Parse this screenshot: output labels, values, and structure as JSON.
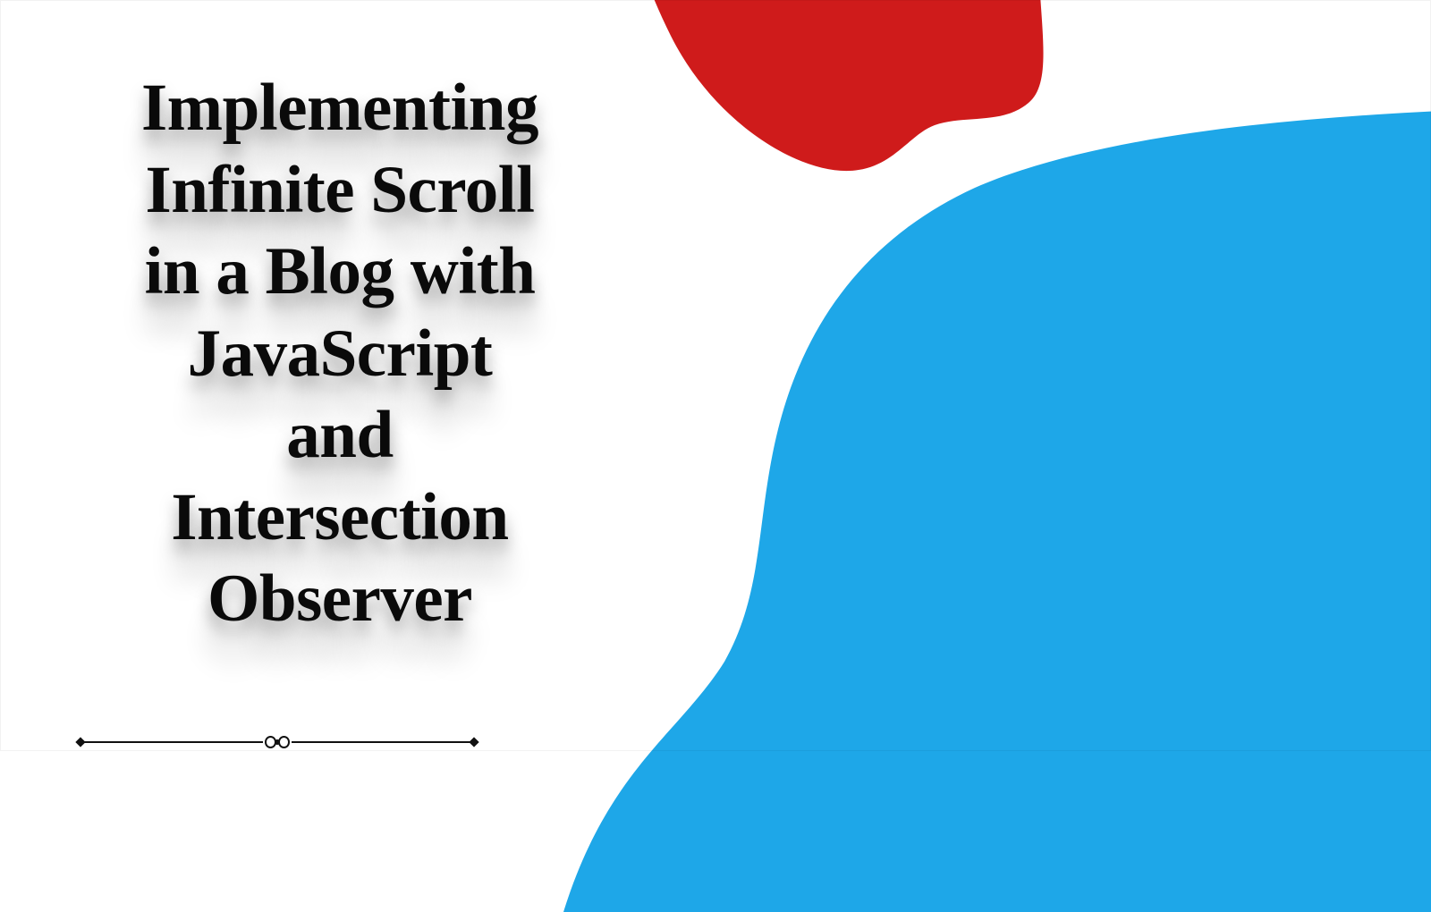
{
  "title": {
    "lines": "Implementing\nInfinite Scroll\nin a Blog with\nJavaScript\nand\nIntersection\nObserver"
  },
  "colors": {
    "red": "#cf1b1b",
    "blue": "#1ea7e8",
    "text": "#0a0a0a"
  }
}
